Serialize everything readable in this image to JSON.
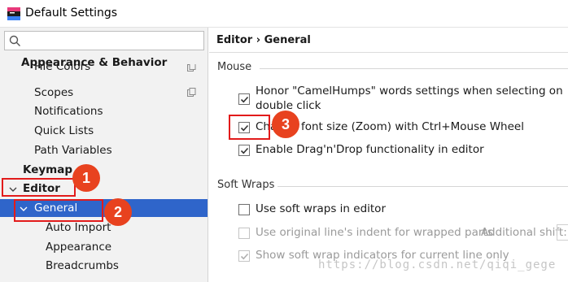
{
  "window": {
    "title": "Default Settings"
  },
  "search": {
    "value": "",
    "placeholder": ""
  },
  "sidebar": {
    "group_header": "Appearance & Behavior",
    "items": [
      {
        "label": "File Colors",
        "has_copy_icon": true
      },
      {
        "label": "Scopes",
        "has_copy_icon": true
      },
      {
        "label": "Notifications",
        "has_copy_icon": false
      },
      {
        "label": "Quick Lists",
        "has_copy_icon": false
      },
      {
        "label": "Path Variables",
        "has_copy_icon": false
      }
    ],
    "keymap": "Keymap",
    "editor": "Editor",
    "general": "General",
    "sub_items": [
      {
        "label": "Auto Import"
      },
      {
        "label": "Appearance"
      },
      {
        "label": "Breadcrumbs"
      }
    ]
  },
  "content": {
    "breadcrumb": "Editor › General",
    "mouse": {
      "title": "Mouse",
      "options": [
        {
          "line1": "Honor \"CamelHumps\" words settings when selecting on",
          "line2": "double click",
          "checked": true
        },
        {
          "label": "Change font size (Zoom) with Ctrl+Mouse Wheel",
          "checked": true
        },
        {
          "label": "Enable Drag'n'Drop functionality in editor",
          "checked": true
        }
      ]
    },
    "soft_wraps": {
      "title": "Soft Wraps",
      "options": [
        {
          "label": "Use soft wraps in editor",
          "checked": false,
          "enabled": true
        },
        {
          "label": "Use original line's indent for wrapped parts",
          "checked": false,
          "enabled": false
        },
        {
          "label": "Show soft wrap indicators for current line only",
          "checked": true,
          "enabled": false
        }
      ],
      "additional_shift_label": "Additional shift:"
    }
  },
  "annotations": [
    "1",
    "2",
    "3"
  ],
  "watermark": "https://blog.csdn.net/qiqi_gege",
  "colors": {
    "selection": "#2f65ca",
    "annotation_red": "#e21b1b",
    "badge": "#e8421f"
  }
}
